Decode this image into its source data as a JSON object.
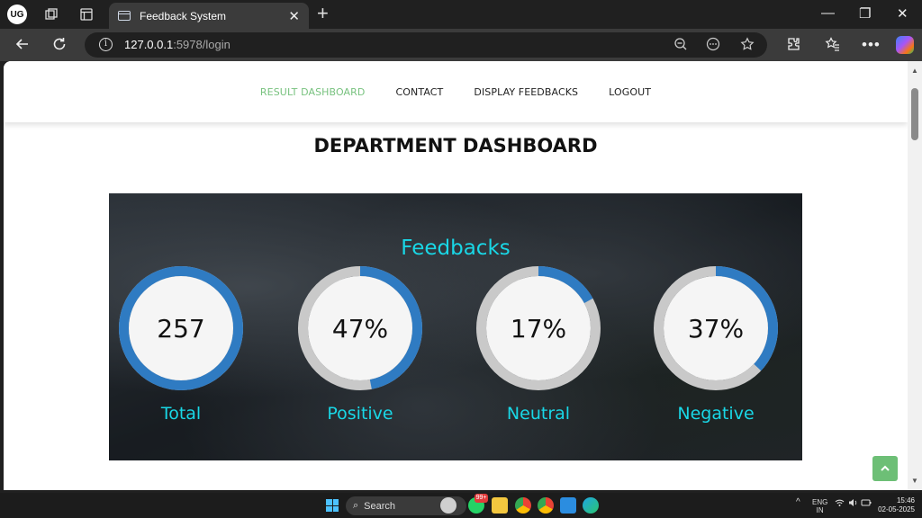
{
  "browser": {
    "profile_initials": "UG",
    "tab_title": "Feedback System",
    "url_host": "127.0.0.1",
    "url_rest": ":5978/login",
    "tab_close_glyph": "✕",
    "new_tab_glyph": "+",
    "minimize_glyph": "—",
    "restore_glyph": "❐",
    "close_glyph": "✕"
  },
  "nav": {
    "items": [
      {
        "label": "RESULT DASHBOARD",
        "active": true
      },
      {
        "label": "CONTACT",
        "active": false
      },
      {
        "label": "DISPLAY FEEDBACKS",
        "active": false
      },
      {
        "label": "LOGOUT",
        "active": false
      }
    ]
  },
  "page": {
    "title": "DEPARTMENT DASHBOARD",
    "section_label": "Feedbacks"
  },
  "stats": [
    {
      "label": "Total",
      "display": "257",
      "fraction": 1.0
    },
    {
      "label": "Positive",
      "display": "47%",
      "fraction": 0.47
    },
    {
      "label": "Neutral",
      "display": "17%",
      "fraction": 0.17
    },
    {
      "label": "Negative",
      "display": "37%",
      "fraction": 0.37
    }
  ],
  "colors": {
    "ring_fill": "#2f7bc2",
    "ring_track": "#c9c9c9",
    "label_cyan": "#19d7e6",
    "nav_active": "#78c27f"
  },
  "taskbar": {
    "search_placeholder": "Search",
    "lang_line1": "ENG",
    "lang_line2": "IN",
    "time": "15:46",
    "date": "02-05-2025",
    "badge": "99+"
  }
}
